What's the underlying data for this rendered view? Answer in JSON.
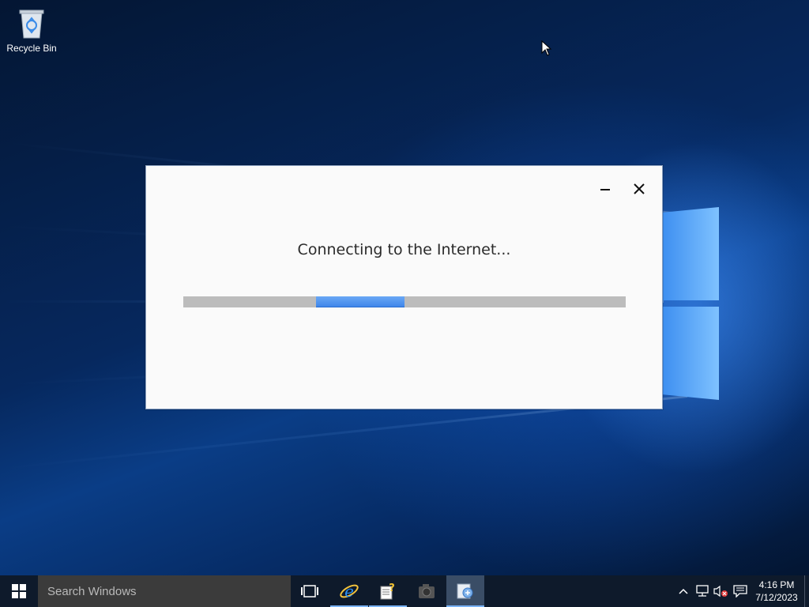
{
  "desktop": {
    "icons": [
      {
        "label": "Recycle Bin",
        "icon": "recycle-bin-icon"
      }
    ]
  },
  "dialog": {
    "message": "Connecting to the Internet...",
    "progress": {
      "mode": "indeterminate",
      "chunk_start_fraction": 0.3,
      "chunk_width_fraction": 0.2
    },
    "accent_color": "#3f86ea",
    "buttons": [
      "minimize-icon",
      "close-icon"
    ]
  },
  "taskbar": {
    "search_placeholder": "Search Windows",
    "apps": [
      {
        "icon": "task-view-icon",
        "state": "normal"
      },
      {
        "icon": "internet-explorer-icon",
        "state": "running"
      },
      {
        "icon": "help-document-icon",
        "state": "running"
      },
      {
        "icon": "camera-icon",
        "state": "normal"
      },
      {
        "icon": "setup-wizard-icon",
        "state": "active"
      }
    ],
    "tray_icons": [
      "chevron-up-icon",
      "network-icon",
      "volume-muted-icon",
      "action-center-icon"
    ],
    "time": "4:16 PM",
    "date": "7/12/2023"
  }
}
